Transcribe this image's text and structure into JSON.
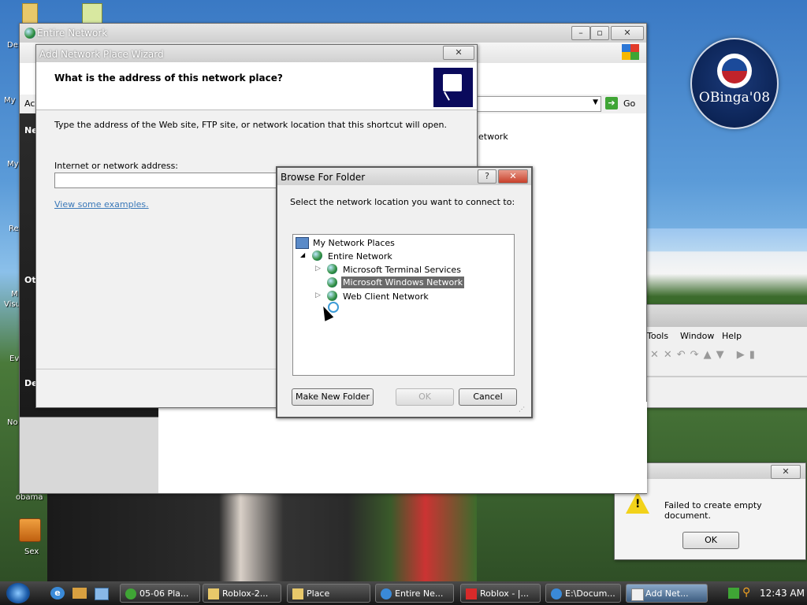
{
  "desktop": {
    "icons": [
      {
        "label": "obama"
      },
      {
        "label": "Sex"
      }
    ],
    "partial_labels": [
      "De",
      "My",
      "My",
      "Re",
      "Ne",
      "Ot",
      "M",
      "Visu",
      "Ev",
      "De",
      "No"
    ],
    "logo_text": "OBinga'08"
  },
  "entire_network_window": {
    "title": "Entire Network",
    "address_placeholder_prefix": "Ac",
    "go_label": "Go",
    "content_fragment": "etwork",
    "side_label": "Ne"
  },
  "wizard": {
    "title": "Add Network Place Wizard",
    "heading": "What is the address of this network place?",
    "description": "Type the address of the Web site, FTP site, or network location that this shortcut will open.",
    "field_label": "Internet or network address:",
    "field_value": "",
    "link": "View some examples."
  },
  "browse_dialog": {
    "title": "Browse For Folder",
    "help_glyph": "?",
    "close_glyph": "✕",
    "prompt": "Select the network location you want to connect to:",
    "tree": [
      {
        "label": "My Network Places",
        "level": 0,
        "expander": ""
      },
      {
        "label": "Entire Network",
        "level": 1,
        "expander": "◢"
      },
      {
        "label": "Microsoft Terminal Services",
        "level": 2,
        "expander": "▷"
      },
      {
        "label": "Microsoft Windows Network",
        "level": 2,
        "expander": "",
        "selected": true
      },
      {
        "label": "Web Client Network",
        "level": 2,
        "expander": "▷"
      }
    ],
    "buttons": {
      "new_folder": "Make New Folder",
      "ok": "OK",
      "cancel": "Cancel"
    }
  },
  "app_window": {
    "menu": [
      "Tools",
      "Window",
      "Help"
    ]
  },
  "error_dialog": {
    "message": "Failed to create empty document.",
    "ok": "OK",
    "close_glyph": "✕"
  },
  "taskbar": {
    "items": [
      {
        "label": "05-06 Pla...",
        "active": false
      },
      {
        "label": "Roblox-2...",
        "active": false
      },
      {
        "label": "Place",
        "active": false
      },
      {
        "label": "Entire Ne...",
        "active": false
      },
      {
        "label": "Roblox - |...",
        "active": false
      },
      {
        "label": "E:\\Docum...",
        "active": false
      },
      {
        "label": "Add Net...",
        "active": true
      }
    ],
    "clock": "12:43 AM"
  },
  "colors": {
    "selection": "#6a6a6a",
    "link": "#3a78b8",
    "wizard_icon_bg": "#0a0a5c"
  }
}
